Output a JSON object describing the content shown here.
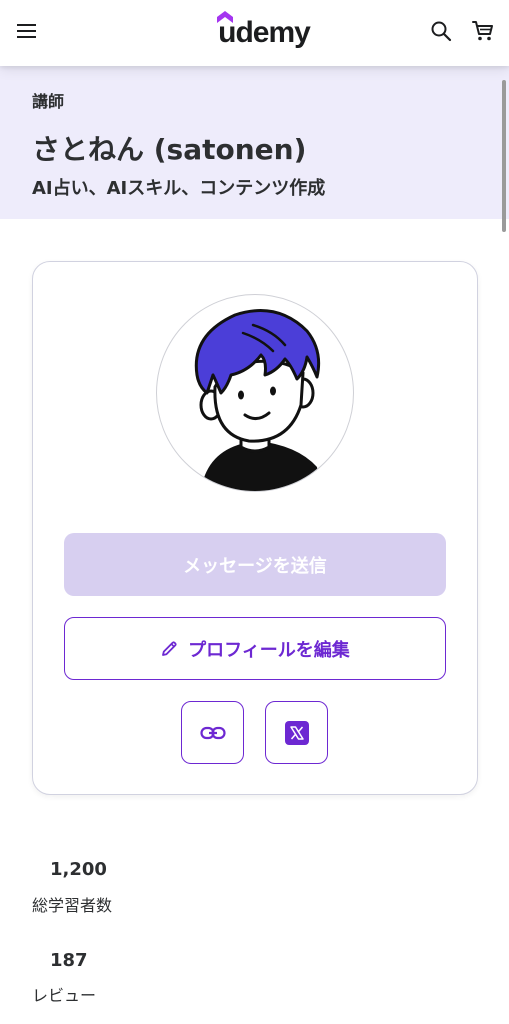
{
  "header": {
    "logo_text": "udemy",
    "icons": [
      "hamburger-menu-icon",
      "search-icon",
      "cart-icon"
    ],
    "brand_color": "#a435f0"
  },
  "hero": {
    "kicker": "講師",
    "name": "さとねん (satonen)",
    "headline": "AI占い、AIスキル、コンテンツ作成"
  },
  "card": {
    "message_button_label": "メッセージを送信",
    "edit_profile_button_label": "プロフィールを編集",
    "social_icons": [
      "link-icon",
      "x-icon"
    ],
    "accent_color": "#6d28d2"
  },
  "stats": [
    {
      "value": "1,200",
      "label": "総学習者数"
    },
    {
      "value": "187",
      "label": "レビュー"
    }
  ]
}
